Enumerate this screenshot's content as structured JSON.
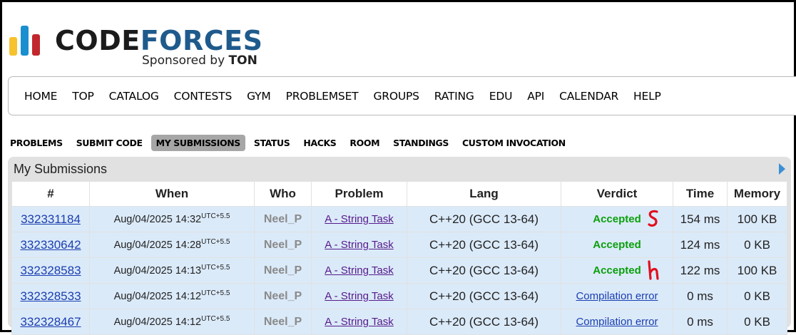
{
  "logo": {
    "word_part1": "CODE",
    "word_part2": "FORCES",
    "sponsor_prefix": "Sponsored by ",
    "sponsor_name": "TON"
  },
  "main_menu": [
    "HOME",
    "TOP",
    "CATALOG",
    "CONTESTS",
    "GYM",
    "PROBLEMSET",
    "GROUPS",
    "RATING",
    "EDU",
    "API",
    "CALENDAR",
    "HELP"
  ],
  "sub_menu": {
    "items": [
      "PROBLEMS",
      "SUBMIT CODE",
      "MY SUBMISSIONS",
      "STATUS",
      "HACKS",
      "ROOM",
      "STANDINGS",
      "CUSTOM INVOCATION"
    ],
    "active": "MY SUBMISSIONS"
  },
  "submissions": {
    "title": "My Submissions",
    "headers": {
      "id": "#",
      "when": "When",
      "who": "Who",
      "problem": "Problem",
      "lang": "Lang",
      "verdict": "Verdict",
      "time": "Time",
      "memory": "Memory"
    },
    "rows": [
      {
        "id": "332331184",
        "when": "Aug/04/2025 14:32",
        "tz": "UTC+5.5",
        "who": "Neel_P",
        "problem": "A - String Task",
        "lang": "C++20 (GCC 13-64)",
        "verdict": "Accepted",
        "time": "154 ms",
        "memory": "100 KB"
      },
      {
        "id": "332330642",
        "when": "Aug/04/2025 14:28",
        "tz": "UTC+5.5",
        "who": "Neel_P",
        "problem": "A - String Task",
        "lang": "C++20 (GCC 13-64)",
        "verdict": "Accepted",
        "time": "124 ms",
        "memory": "0 KB"
      },
      {
        "id": "332328583",
        "when": "Aug/04/2025 14:13",
        "tz": "UTC+5.5",
        "who": "Neel_P",
        "problem": "A - String Task",
        "lang": "C++20 (GCC 13-64)",
        "verdict": "Accepted",
        "time": "122 ms",
        "memory": "100 KB"
      },
      {
        "id": "332328533",
        "when": "Aug/04/2025 14:12",
        "tz": "UTC+5.5",
        "who": "Neel_P",
        "problem": "A - String Task",
        "lang": "C++20 (GCC 13-64)",
        "verdict": "Compilation error",
        "time": "0 ms",
        "memory": "0 KB"
      },
      {
        "id": "332328467",
        "when": "Aug/04/2025 14:12",
        "tz": "UTC+5.5",
        "who": "Neel_P",
        "problem": "A - String Task",
        "lang": "C++20 (GCC 13-64)",
        "verdict": "Compilation error",
        "time": "0 ms",
        "memory": "0 KB"
      }
    ]
  },
  "colors": {
    "accepted": "#0a9f0a",
    "link": "#1a3eb0",
    "problem_link": "#551a8b",
    "row_bg": "#dbeaf9",
    "annotation_red": "#e0101e"
  }
}
